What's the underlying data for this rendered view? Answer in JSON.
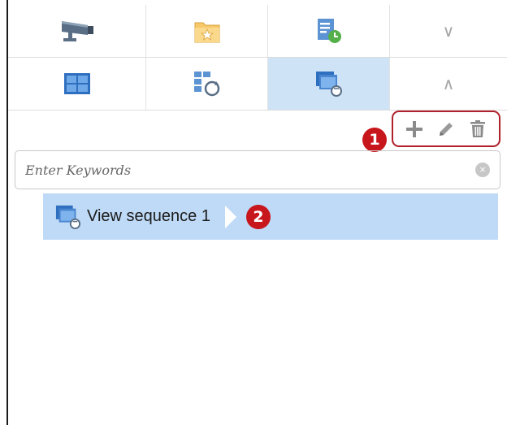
{
  "tabs_row1": [
    {
      "icon": "camera-icon"
    },
    {
      "icon": "favorite-folder-icon"
    },
    {
      "icon": "schedule-view-icon"
    },
    {
      "icon": "chevron-down-icon",
      "glyph": "∨"
    }
  ],
  "tabs_row2": [
    {
      "icon": "view-grid-icon"
    },
    {
      "icon": "view-rotate-icon"
    },
    {
      "icon": "view-sequence-icon",
      "active": true
    },
    {
      "icon": "chevron-up-icon",
      "glyph": "∧"
    }
  ],
  "callouts": {
    "badge1": "1",
    "badge2": "2"
  },
  "toolbar": {
    "icons": [
      "add-icon",
      "edit-icon",
      "delete-icon"
    ]
  },
  "search": {
    "placeholder": "Enter Keywords",
    "value": ""
  },
  "tree": {
    "items": [
      {
        "label": "View sequence 1",
        "icon": "view-sequence-icon"
      }
    ]
  },
  "colors": {
    "accent": "#cfe3f7",
    "selection": "#bfdaf6",
    "callout": "#c8161d",
    "highlight_border": "#b0202a"
  }
}
